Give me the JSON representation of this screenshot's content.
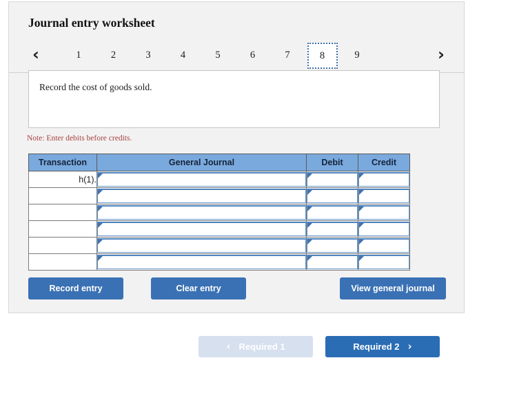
{
  "worksheet": {
    "title": "Journal entry worksheet",
    "prev_icon": "chevron-left-icon",
    "prev_glyph": "‹",
    "next_icon": "chevron-right-icon",
    "next_glyph": "›",
    "tabs": [
      {
        "label": "1",
        "active": false
      },
      {
        "label": "2",
        "active": false
      },
      {
        "label": "3",
        "active": false
      },
      {
        "label": "4",
        "active": false
      },
      {
        "label": "5",
        "active": false
      },
      {
        "label": "6",
        "active": false
      },
      {
        "label": "7",
        "active": false
      },
      {
        "label": "8",
        "active": true
      },
      {
        "label": "9",
        "active": false
      }
    ],
    "prompt": "Record the cost of goods sold.",
    "note": "Note: Enter debits before credits."
  },
  "table": {
    "headers": [
      "Transaction",
      "General Journal",
      "Debit",
      "Credit"
    ],
    "rows": [
      {
        "transaction": "h(1).",
        "general_journal": "",
        "debit": "",
        "credit": ""
      },
      {
        "transaction": "",
        "general_journal": "",
        "debit": "",
        "credit": ""
      },
      {
        "transaction": "",
        "general_journal": "",
        "debit": "",
        "credit": ""
      },
      {
        "transaction": "",
        "general_journal": "",
        "debit": "",
        "credit": ""
      },
      {
        "transaction": "",
        "general_journal": "",
        "debit": "",
        "credit": ""
      },
      {
        "transaction": "",
        "general_journal": "",
        "debit": "",
        "credit": ""
      }
    ]
  },
  "actions": {
    "record_entry": "Record entry",
    "clear_entry": "Clear entry",
    "view_general_journal": "View general journal"
  },
  "bottom_nav": {
    "prev_label": "Required 1",
    "prev_chevron": "‹",
    "prev_icon": "chevron-left-icon",
    "next_label": "Required 2",
    "next_chevron": "›",
    "next_icon": "chevron-right-icon"
  },
  "colors": {
    "card_background": "#f2f2f2",
    "table_header_blue": "#7aa9dd",
    "button_blue": "#3a71b4",
    "nav_active_blue": "#2a6db5",
    "nav_disabled_blue": "#d6e0ef",
    "note_red": "#a8423f",
    "tab_active_border": "#3c6fa8",
    "input_border_blue": "#4e84c0"
  }
}
